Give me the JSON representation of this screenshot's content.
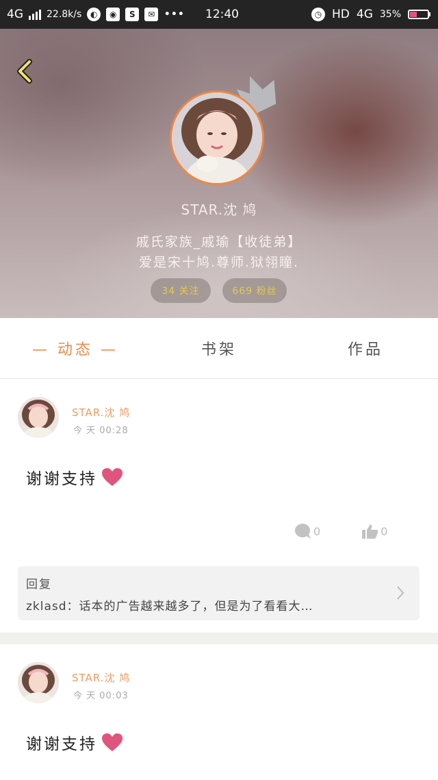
{
  "status_bar": {
    "network": "4G",
    "speed": "22.8k/s",
    "time": "12:40",
    "hd": "HD",
    "net2": "4G",
    "battery": "35%"
  },
  "profile": {
    "username": "STAR.沈 鸠",
    "bio_line1": "戚氏家族_戚瑜【收徒弟】",
    "bio_line2": "爱是宋十鸠.尊师.狱翎瞳.",
    "following": "34 关注",
    "followers": "669 粉丝"
  },
  "tabs": [
    {
      "label": "— 动态 —",
      "active": true
    },
    {
      "label": "书架",
      "active": false
    },
    {
      "label": "作品",
      "active": false
    }
  ],
  "posts": [
    {
      "author": "STAR.沈 鸠",
      "time": "今 天 00:28",
      "text": "谢谢支持",
      "comments": "0",
      "likes": "0",
      "reply_title": "回复",
      "reply_text": "zklasd：话本的广告越来越多了，但是为了看看大…"
    },
    {
      "author": "STAR.沈 鸠",
      "time": "今 天 00:03",
      "text": "谢谢支持"
    }
  ],
  "colors": {
    "accent": "#ee8a47",
    "name": "#ee9a62",
    "heart": "#e0557e",
    "pill_text": "#e8c84a"
  }
}
